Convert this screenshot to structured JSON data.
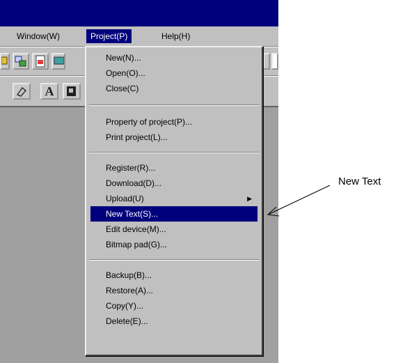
{
  "menubar": {
    "items": [
      {
        "label": "Window(W)"
      },
      {
        "label": "Project(P)"
      },
      {
        "label": "Help(H)"
      }
    ]
  },
  "project_menu": {
    "items": [
      {
        "label": "New(N)..."
      },
      {
        "label": "Open(O)..."
      },
      {
        "label": "Close(C)"
      },
      {
        "label": "Property of project(P)..."
      },
      {
        "label": "Print project(L)..."
      },
      {
        "label": "Register(R)..."
      },
      {
        "label": "Download(D)..."
      },
      {
        "label": "Upload(U)"
      },
      {
        "label": "New Text(S)..."
      },
      {
        "label": "Edit device(M)..."
      },
      {
        "label": "Bitmap pad(G)..."
      },
      {
        "label": "Backup(B)..."
      },
      {
        "label": "Restore(A)..."
      },
      {
        "label": "Copy(Y)..."
      },
      {
        "label": "Delete(E)..."
      }
    ]
  },
  "toolbar": {
    "text_tool_glyph": "A"
  },
  "callout": {
    "label": "New Text"
  },
  "colors": {
    "title_bar": "#00007c",
    "highlight": "#00007c",
    "face": "#c0c0c0",
    "workspace": "#a0a0a0"
  }
}
